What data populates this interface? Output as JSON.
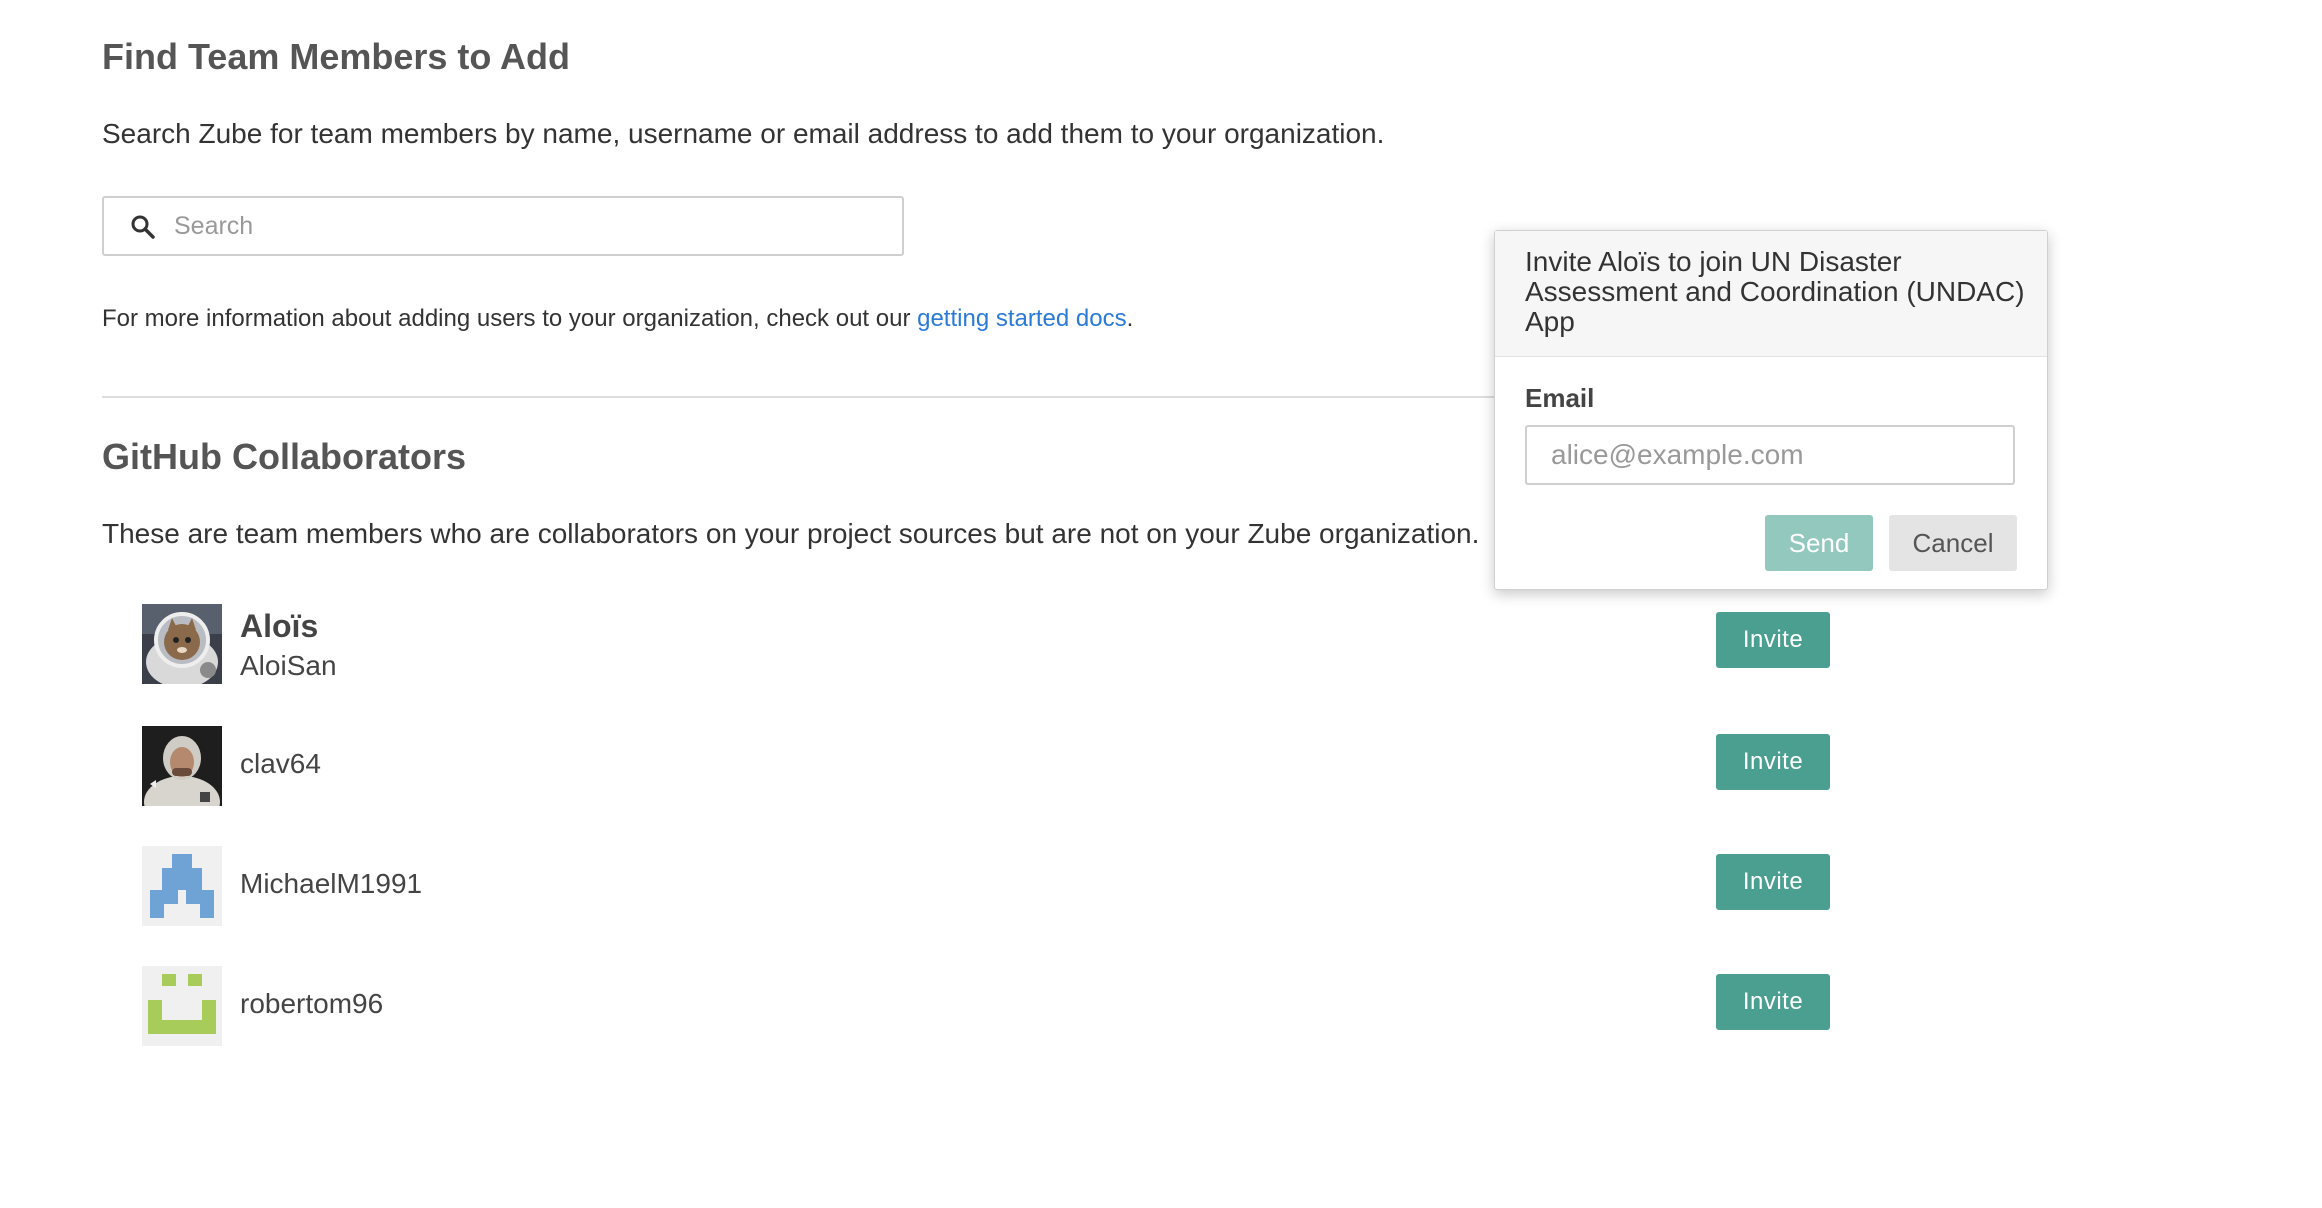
{
  "find": {
    "title": "Find Team Members to Add",
    "description": "Search Zube for team members by name, username or email address to add them to your organization.",
    "search_placeholder": "Search",
    "search_icon": "search-icon",
    "more_info_prefix": "For more information about adding users to your organization, check out our ",
    "more_info_link": "getting started docs",
    "more_info_suffix": "."
  },
  "github": {
    "title": "GitHub Collaborators",
    "description": "These are team members who are collaborators on your project sources but are not on your Zube organization.",
    "members": [
      {
        "name": "Aloïs",
        "username": "AloiSan",
        "avatar": "astronaut-cat-photo",
        "invite_label": "Invite"
      },
      {
        "username": "clav64",
        "avatar": "person-hoodie-photo",
        "invite_label": "Invite"
      },
      {
        "username": "MichaelM1991",
        "avatar": "blue-identicon",
        "invite_label": "Invite"
      },
      {
        "username": "robertom96",
        "avatar": "green-identicon",
        "invite_label": "Invite"
      }
    ]
  },
  "invite_popover": {
    "title": "Invite Aloïs to join UN Disaster Assessment and Coordination (UNDAC) App",
    "email_label": "Email",
    "email_placeholder": "alice@example.com",
    "send_label": "Send",
    "cancel_label": "Cancel"
  },
  "colors": {
    "invite_button": "#4a9f91",
    "send_button_disabled": "#93c8bf",
    "cancel_button": "#e4e4e4",
    "link": "#2a7ad6",
    "identicon_blue": "#6fa3d6",
    "identicon_green": "#a8cc5a"
  }
}
